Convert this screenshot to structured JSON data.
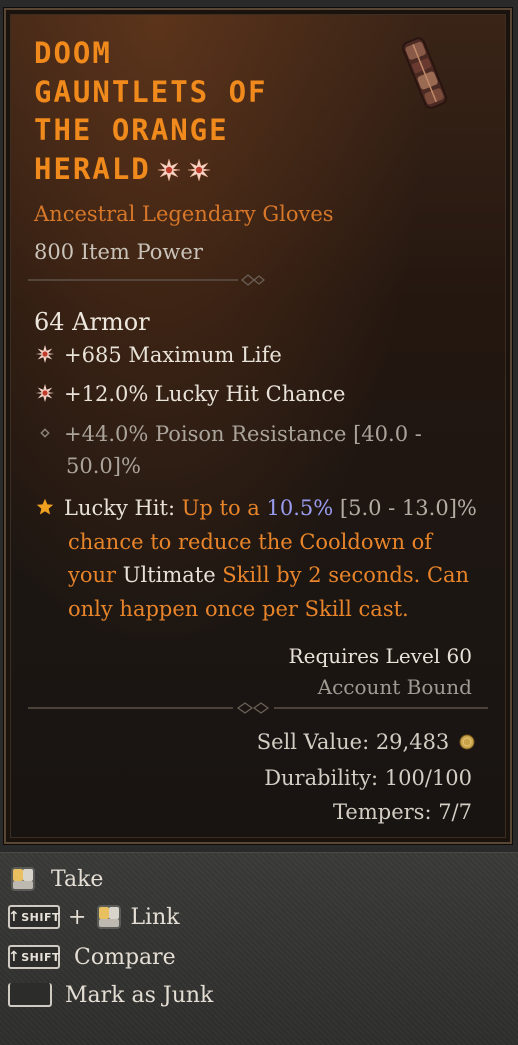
{
  "item": {
    "name_lines": [
      "Doom",
      "Gauntlets of",
      "the Orange",
      "Herald"
    ],
    "type": "Ancestral Legendary Gloves",
    "power": "800 Item Power",
    "armor": "64 Armor",
    "affixes": [
      {
        "text": "+685 Maximum Life",
        "icon": "greater-affix-icon"
      },
      {
        "text": "+12.0% Lucky Hit Chance",
        "icon": "greater-affix-icon"
      },
      {
        "text": "+44.0% Poison Resistance [40.0 -",
        "icon": "diamond-bullet-icon"
      },
      {
        "text": "50.0]%",
        "icon": ""
      }
    ],
    "legendary": {
      "lead": "Lucky Hit:",
      "mid1": " Up to a ",
      "value": "10.5%",
      "range": " [5.0 - 13.0]%",
      "rest1": "chance to reduce the Cooldown of",
      "your": "your ",
      "ultimate": "Ultimate",
      "rest2": " Skill by 2 seconds. Can",
      "rest3": "only happen once per Skill cast."
    },
    "requires": "Requires Level 60",
    "bound": "Account Bound",
    "sell_value": "Sell Value: 29,483",
    "durability": "Durability: 100/100",
    "tempers": "Tempers: 7/7"
  },
  "actions": [
    {
      "label": "Take"
    },
    {
      "label": "Link",
      "plus": "+"
    },
    {
      "label": "Compare"
    },
    {
      "label": "Mark as Junk"
    }
  ],
  "keys": {
    "shift": "SHIFT"
  },
  "colors": {
    "title": "#f08a1c",
    "legendary": "#e8842a",
    "value_blue": "#9a9cf0"
  }
}
